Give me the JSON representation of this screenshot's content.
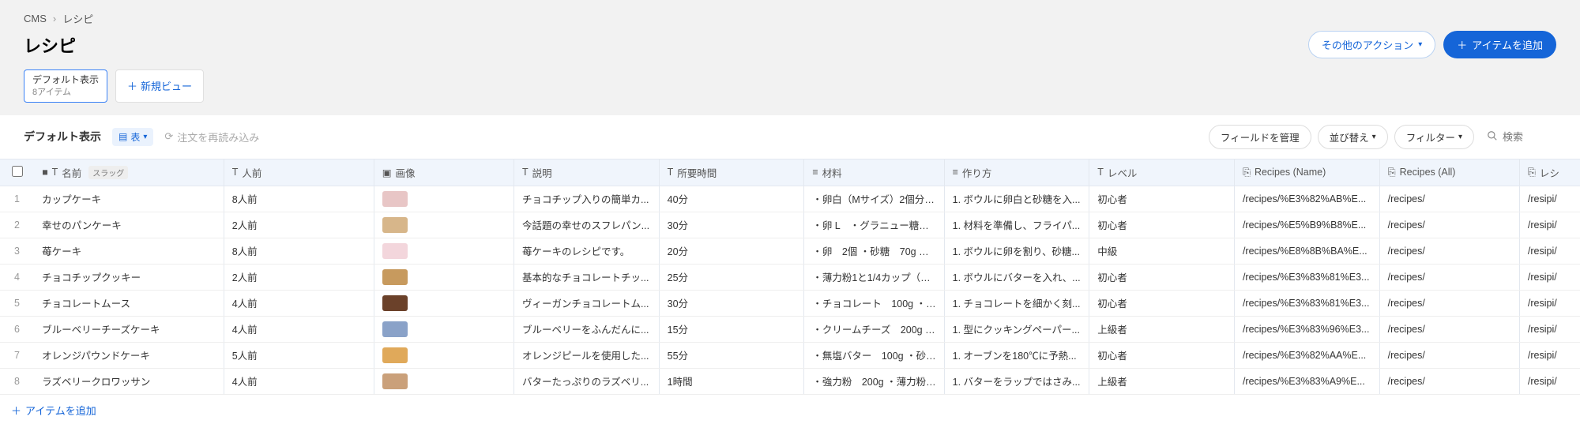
{
  "breadcrumb": {
    "parent": "CMS",
    "current": "レシピ"
  },
  "page_title": "レシピ",
  "header_actions": {
    "other_actions": "その他のアクション",
    "add_item": "アイテムを追加"
  },
  "views": {
    "default": {
      "name": "デフォルト表示",
      "count_label": "8アイテム"
    },
    "new_view": "新規ビュー"
  },
  "toolbar": {
    "view_name": "デフォルト表示",
    "mode_label": "表",
    "reload_label": "注文を再読み込み",
    "manage_fields": "フィールドを管理",
    "sort": "並び替え",
    "filter": "フィルター",
    "search_placeholder": "検索"
  },
  "columns": {
    "name": "名前",
    "name_badge": "スラッグ",
    "servings": "人前",
    "image": "画像",
    "description": "説明",
    "time": "所要時間",
    "ingredients": "材料",
    "howto": "作り方",
    "level": "レベル",
    "recipes_name": "Recipes (Name)",
    "recipes_all": "Recipes (All)",
    "recipes_trunc": "レシ"
  },
  "rows": [
    {
      "num": "1",
      "name": "カップケーキ",
      "servings": "8人前",
      "thumb": "#e8c6c6",
      "description": "チョコチップ入りの簡単カ...",
      "time": "40分",
      "ingredients": "・卵白（Mサイズ）2個分・...",
      "howto": "1. ボウルに卵白と砂糖を入...",
      "level": "初心者",
      "recipes_name": "/recipes/%E3%82%AB%E...",
      "recipes_all": "/recipes/",
      "recipes_trunc": "/resipi/"
    },
    {
      "num": "2",
      "name": "幸せのパンケーキ",
      "servings": "2人前",
      "thumb": "#d7b68a",
      "description": "今話題の幸せのスフレパン...",
      "time": "30分",
      "ingredients": "・卵 L　・グラニュー糖　・...",
      "howto": "1. 材料を準備し、フライパ...",
      "level": "初心者",
      "recipes_name": "/recipes/%E5%B9%B8%E...",
      "recipes_all": "/recipes/",
      "recipes_trunc": "/resipi/"
    },
    {
      "num": "3",
      "name": "苺ケーキ",
      "servings": "8人前",
      "thumb": "#f3d6dc",
      "description": "苺ケーキのレシピです。",
      "time": "20分",
      "ingredients": "・卵　2個 ・砂糖　70g ・薄...",
      "howto": "1. ボウルに卵を割り、砂糖...",
      "level": "中級",
      "recipes_name": "/recipes/%E8%8B%BA%E...",
      "recipes_all": "/recipes/",
      "recipes_trunc": "/resipi/"
    },
    {
      "num": "4",
      "name": "チョコチップクッキー",
      "servings": "2人前",
      "thumb": "#c79a5e",
      "description": "基本的なチョコレートチッ...",
      "time": "25分",
      "ingredients": "・薄力粉1と1/4カップ（約1...",
      "howto": "1. ボウルにバターを入れ、...",
      "level": "初心者",
      "recipes_name": "/recipes/%E3%83%81%E3...",
      "recipes_all": "/recipes/",
      "recipes_trunc": "/resipi/"
    },
    {
      "num": "5",
      "name": "チョコレートムース",
      "servings": "4人前",
      "thumb": "#6b412a",
      "description": "ヴィーガンチョコレートム...",
      "time": "30分",
      "ingredients": "・チョコレート　100g ・コ...",
      "howto": "1. チョコレートを細かく刻...",
      "level": "初心者",
      "recipes_name": "/recipes/%E3%83%81%E3...",
      "recipes_all": "/recipes/",
      "recipes_trunc": "/resipi/"
    },
    {
      "num": "6",
      "name": "ブルーベリーチーズケーキ",
      "servings": "4人前",
      "thumb": "#8aa2c8",
      "description": "ブルーベリーをふんだんに...",
      "time": "15分",
      "ingredients": "・クリームチーズ　200g ・...",
      "howto": "1. 型にクッキングペーパー...",
      "level": "上級者",
      "recipes_name": "/recipes/%E3%83%96%E3...",
      "recipes_all": "/recipes/",
      "recipes_trunc": "/resipi/"
    },
    {
      "num": "7",
      "name": "オレンジパウンドケーキ",
      "servings": "5人前",
      "thumb": "#e0a95a",
      "description": "オレンジピールを使用した...",
      "time": "55分",
      "ingredients": "・無塩バター　100g ・砂糖...",
      "howto": "1. オーブンを180℃に予熱...",
      "level": "初心者",
      "recipes_name": "/recipes/%E3%82%AA%E...",
      "recipes_all": "/recipes/",
      "recipes_trunc": "/resipi/"
    },
    {
      "num": "8",
      "name": "ラズベリークロワッサン",
      "servings": "4人前",
      "thumb": "#caa07a",
      "description": "バターたっぷりのラズベリ...",
      "time": "1時間",
      "ingredients": "・強力粉　200g ・薄力粉　...",
      "howto": "1. バターをラップではさみ...",
      "level": "上級者",
      "recipes_name": "/recipes/%E3%83%A9%E...",
      "recipes_all": "/recipes/",
      "recipes_trunc": "/resipi/"
    }
  ],
  "footer": {
    "add_item": "アイテムを追加"
  }
}
